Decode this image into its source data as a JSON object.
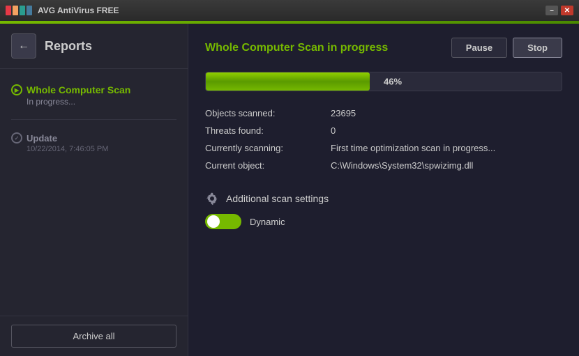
{
  "titleBar": {
    "appName": "AVG  AntiVirus FREE",
    "minLabel": "–",
    "closeLabel": "✕"
  },
  "sidebar": {
    "backArrow": "←",
    "title": "Reports",
    "items": [
      {
        "id": "whole-computer-scan",
        "name": "Whole Computer Scan",
        "status": "In progress...",
        "active": true,
        "icon": "▶"
      },
      {
        "id": "update",
        "name": "Update",
        "timestamp": "10/22/2014, 7:46:05 PM",
        "active": false,
        "icon": "✓"
      }
    ],
    "archiveLabel": "Archive all"
  },
  "mainContent": {
    "scanTitle": "Whole Computer Scan",
    "scanTitleSuffix": " in progress",
    "pauseLabel": "Pause",
    "stopLabel": "Stop",
    "progress": {
      "percent": 46,
      "label": "46%"
    },
    "details": [
      {
        "label": "Objects scanned:",
        "value": "23695"
      },
      {
        "label": "Threats found:",
        "value": "0"
      },
      {
        "label": "Currently scanning:",
        "value": "First time optimization scan in progress..."
      },
      {
        "label": "Current object:",
        "value": "C:\\Windows\\System32\\spwizimg.dll"
      }
    ],
    "additionalSettings": {
      "label": "Additional scan settings",
      "dynamic": {
        "label": "Dynamic",
        "toggleOn": true
      }
    }
  }
}
